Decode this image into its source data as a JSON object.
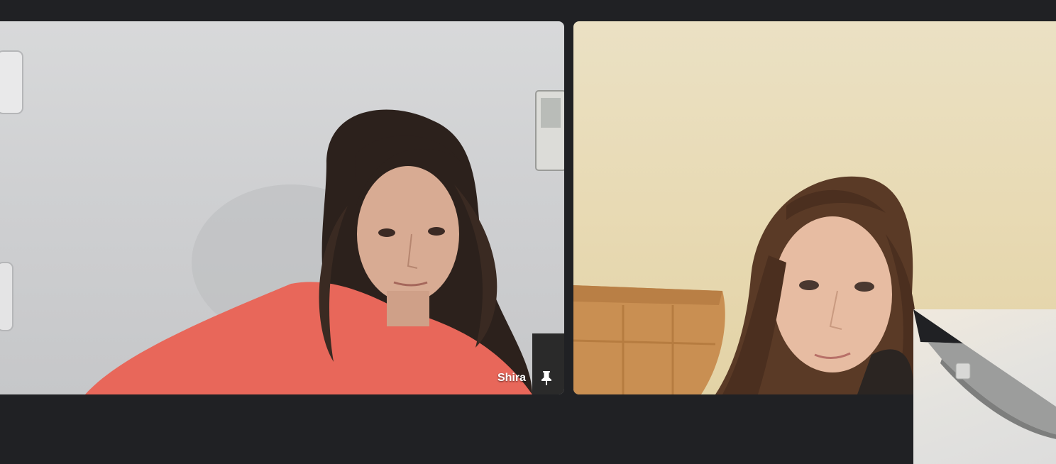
{
  "meeting": {
    "participants": [
      {
        "name": "Shira",
        "pinned": false
      },
      {
        "name": ""
      }
    ]
  },
  "icons": {
    "pin": "pin-icon"
  },
  "colors": {
    "background": "#202124",
    "label_text": "#ffffff"
  }
}
